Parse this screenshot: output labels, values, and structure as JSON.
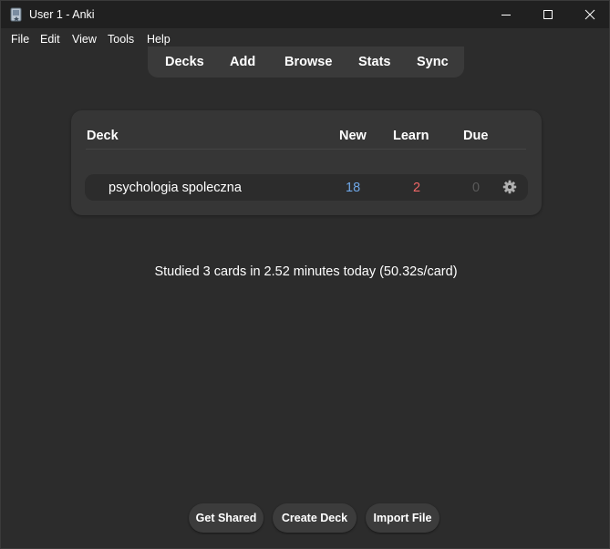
{
  "window": {
    "title": "User 1 - Anki"
  },
  "menu": {
    "items": [
      "File",
      "Edit",
      "View",
      "Tools",
      "Help"
    ]
  },
  "toolbar": {
    "tabs": [
      "Decks",
      "Add",
      "Browse",
      "Stats",
      "Sync"
    ]
  },
  "deck_table": {
    "headers": {
      "deck": "Deck",
      "new": "New",
      "learn": "Learn",
      "due": "Due"
    },
    "rows": [
      {
        "name": "psychologia spoleczna",
        "new": "18",
        "learn": "2",
        "due": "0"
      }
    ]
  },
  "stats": {
    "studied_text": "Studied 3 cards in 2.52 minutes today (50.32s/card)"
  },
  "buttons": {
    "get_shared": "Get Shared",
    "create_deck": "Create Deck",
    "import_file": "Import File"
  },
  "colors": {
    "background": "#2c2c2c",
    "titlebar": "#202020",
    "card": "#363636",
    "new_count": "#6ea6e6",
    "learn_count": "#ef6767",
    "due_count": "#5a5a5a"
  },
  "icons": {
    "app": "anki-app-icon",
    "minimize": "minimize-icon",
    "maximize": "maximize-icon",
    "close": "close-icon",
    "deck_options": "gear-icon"
  }
}
